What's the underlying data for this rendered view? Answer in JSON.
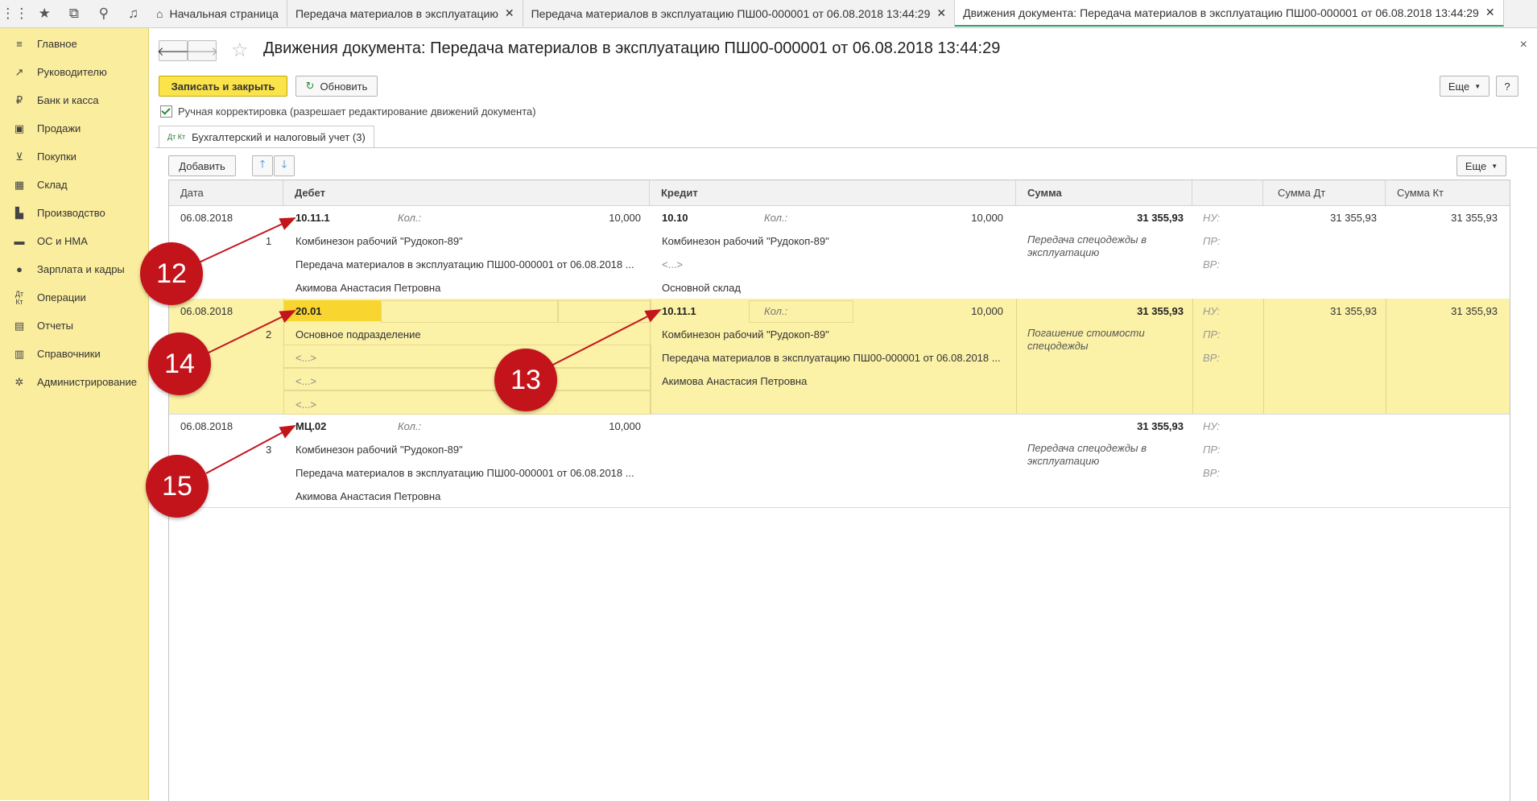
{
  "topbar": {
    "tabs": [
      {
        "label": "Начальная страница",
        "icon": "home-icon"
      },
      {
        "label": "Передача материалов в эксплуатацию",
        "close": "✕"
      },
      {
        "label": "Передача материалов в эксплуатацию ПШ00-000001 от 06.08.2018 13:44:29",
        "close": "✕"
      },
      {
        "label": "Движения документа: Передача материалов в эксплуатацию ПШ00-000001 от 06.08.2018 13:44:29",
        "close": "✕"
      }
    ]
  },
  "sidebar": {
    "items": [
      {
        "label": "Главное",
        "icon": "menu-icon"
      },
      {
        "label": "Руководителю",
        "icon": "chart-icon"
      },
      {
        "label": "Банк и касса",
        "icon": "ruble-icon"
      },
      {
        "label": "Продажи",
        "icon": "bag-icon"
      },
      {
        "label": "Покупки",
        "icon": "cart-icon"
      },
      {
        "label": "Склад",
        "icon": "warehouse-icon"
      },
      {
        "label": "Производство",
        "icon": "factory-icon"
      },
      {
        "label": "ОС и НМА",
        "icon": "truck-icon"
      },
      {
        "label": "Зарплата и кадры",
        "icon": "person-icon"
      },
      {
        "label": "Операции",
        "icon": "dtkt-icon"
      },
      {
        "label": "Отчеты",
        "icon": "report-icon"
      },
      {
        "label": "Справочники",
        "icon": "book-icon"
      },
      {
        "label": "Администрирование",
        "icon": "gear-icon"
      }
    ]
  },
  "header": {
    "title": "Движения документа: Передача материалов в эксплуатацию ПШ00-000001 от 06.08.2018 13:44:29",
    "close": "×"
  },
  "toolbar": {
    "save_close": "Записать и закрыть",
    "refresh": "Обновить",
    "more": "Еще",
    "help": "?"
  },
  "manual_edit": {
    "label": "Ручная корректировка (разрешает редактирование движений документа)",
    "checked": true
  },
  "subtab": {
    "icon_text": "Дт Кт",
    "label": "Бухгалтерский и налоговый учет (3)"
  },
  "grid_toolbar": {
    "add": "Добавить",
    "more": "Еще"
  },
  "columns": {
    "date": "Дата",
    "debit": "Дебет",
    "credit": "Кредит",
    "sum": "Сумма",
    "sum_dt": "Сумма Дт",
    "sum_kt": "Сумма Кт"
  },
  "rows": [
    {
      "date": "06.08.2018",
      "num": "1",
      "debit_account": "10.11.1",
      "debit_qty_label": "Кол.:",
      "debit_qty": "10,000",
      "debit_sub": [
        "Комбинезон рабочий \"Рудокоп-89\"",
        "Передача материалов в эксплуатацию ПШ00-000001 от 06.08.2018 ...",
        "Акимова Анастасия Петровна"
      ],
      "credit_account": "10.10",
      "credit_qty_label": "Кол.:",
      "credit_qty": "10,000",
      "credit_sub": [
        "Комбинезон рабочий \"Рудокоп-89\"",
        "<...>",
        "Основной склад"
      ],
      "sum": "31 355,93",
      "content": "Передача спецодежды в эксплуатацию",
      "nu": "НУ:",
      "pr": "ПР:",
      "vr": "ВР:",
      "sum_dt": "31 355,93",
      "sum_kt": "31 355,93"
    },
    {
      "date": "06.08.2018",
      "num": "2",
      "debit_account": "20.01",
      "debit_sub": [
        "Основное подразделение",
        "<...>",
        "<...>",
        "<...>"
      ],
      "credit_account": "10.11.1",
      "credit_qty_label": "Кол.:",
      "credit_qty": "10,000",
      "credit_sub": [
        "Комбинезон рабочий \"Рудокоп-89\"",
        "Передача материалов в эксплуатацию ПШ00-000001 от 06.08.2018 ...",
        "Акимова Анастасия Петровна"
      ],
      "sum": "31 355,93",
      "content": "Погашение стоимости спецодежды",
      "nu": "НУ:",
      "pr": "ПР:",
      "vr": "ВР:",
      "sum_dt": "31 355,93",
      "sum_kt": "31 355,93"
    },
    {
      "date": "06.08.2018",
      "num": "3",
      "debit_account": "МЦ.02",
      "debit_qty_label": "Кол.:",
      "debit_qty": "10,000",
      "debit_sub": [
        "Комбинезон рабочий \"Рудокоп-89\"",
        "Передача материалов в эксплуатацию ПШ00-000001 от 06.08.2018 ...",
        "Акимова Анастасия Петровна"
      ],
      "sum": "31 355,93",
      "content": "Передача спецодежды в эксплуатацию",
      "nu": "НУ:",
      "pr": "ПР:",
      "vr": "ВР:"
    }
  ],
  "callouts": [
    "12",
    "14",
    "13",
    "15"
  ],
  "colors": {
    "sidebar": "#fbed9e",
    "selected_row": "#fbf1a7",
    "primary_button": "#fbe34a",
    "callout": "#c3141b",
    "active_tab_line": "#2aa06b"
  }
}
